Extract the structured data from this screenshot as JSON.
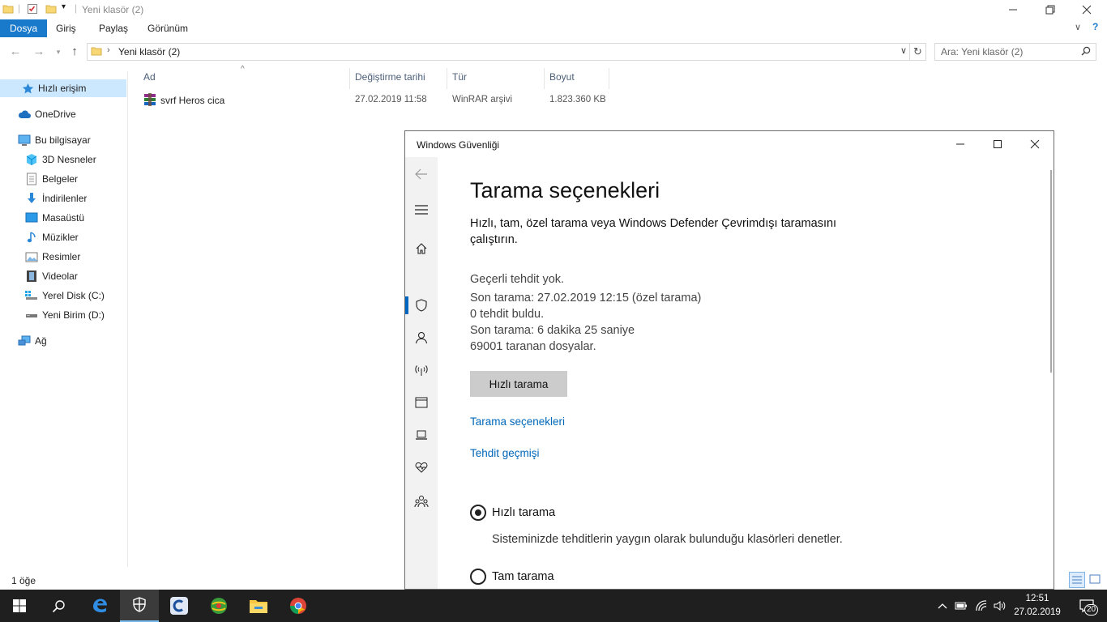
{
  "explorer": {
    "title": "Yeni klasör (2)",
    "ribbon_tabs": [
      "Dosya",
      "Giriş",
      "Paylaş",
      "Görünüm"
    ],
    "address": "Yeni klasör (2)",
    "search_placeholder": "Ara: Yeni klasör (2)",
    "nav": {
      "quick_access": "Hızlı erişim",
      "onedrive": "OneDrive",
      "this_pc": "Bu bilgisayar",
      "items": [
        "3D Nesneler",
        "Belgeler",
        "İndirilenler",
        "Masaüstü",
        "Müzikler",
        "Resimler",
        "Videolar",
        "Yerel Disk (C:)",
        "Yeni Birim (D:)"
      ],
      "network": "Ağ"
    },
    "columns": [
      "Ad",
      "Değiştirme tarihi",
      "Tür",
      "Boyut"
    ],
    "files": [
      {
        "name": "svrf Heros cica",
        "date": "27.02.2019 11:58",
        "type": "WinRAR arşivi",
        "size": "1.823.360 KB"
      }
    ],
    "status": "1 öğe"
  },
  "security": {
    "window_title": "Windows Güvenliği",
    "heading": "Tarama seçenekleri",
    "description": "Hızlı, tam, özel tarama veya Windows Defender Çevrimdışı taramasını çalıştırın.",
    "stats": [
      "Geçerli tehdit yok.",
      "Son tarama: 27.02.2019 12:15 (özel tarama)",
      "0 tehdit buldu.",
      "Son tarama: 6 dakika 25 saniye",
      "69001 taranan dosyalar."
    ],
    "scan_button": "Hızlı tarama",
    "links": [
      "Tarama seçenekleri",
      "Tehdit geçmişi"
    ],
    "options": [
      {
        "label": "Hızlı tarama",
        "desc": "Sisteminizde tehditlerin yaygın olarak bulunduğu klasörleri denetler.",
        "selected": true
      },
      {
        "label": "Tam tarama",
        "desc": "",
        "selected": false
      }
    ]
  },
  "taskbar": {
    "time": "12:51",
    "date": "27.02.2019",
    "notification_count": "20"
  },
  "colors": {
    "accent": "#1979ca",
    "link": "#0067b8",
    "selected_nav": "#cce8ff",
    "taskbar": "#1f1f1f"
  }
}
